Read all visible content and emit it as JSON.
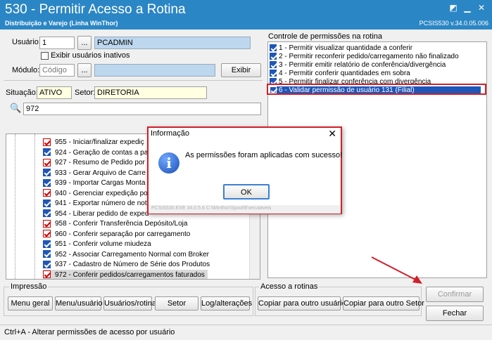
{
  "window": {
    "title": "530 - Permitir Acesso a Rotina",
    "subtitle": "Distribuição e Varejo (Linha WinThor)",
    "version": "PCSIS530  v.34.0.05.006"
  },
  "form": {
    "usuario_label": "Usuário:",
    "usuario_code": "1",
    "usuario_name": "PCADMIN",
    "ellipsis": "...",
    "inativos_label": "Exibir usuários inativos",
    "modulo_label": "Módulo:",
    "modulo_placeholder": "Código",
    "exibir_label": "Exibir",
    "situacao_label": "Situação:",
    "situacao_value": "ATIVO",
    "setor_label": "Setor:",
    "setor_value": "DIRETORIA",
    "search_value": "972"
  },
  "controle": {
    "title": "Controle de permissões na rotina",
    "items": [
      {
        "label": "1 - Permitir visualizar quantidade a conferir",
        "checked": true
      },
      {
        "label": "2 - Permitir reconferir pedido/carregamento não finalizado",
        "checked": true
      },
      {
        "label": "3 - Permitir emitir relatório de conferência/divergência",
        "checked": true
      },
      {
        "label": "4 - Permitir conferir quantidades em sobra",
        "checked": true
      },
      {
        "label": "5 - Permitir finalizar conferência com divergência",
        "checked": true
      },
      {
        "label": "6 - Validar permissão de usuário 131 (Filial)",
        "checked": true
      }
    ]
  },
  "rotinas": [
    {
      "label": "955 - Iniciar/finalizar expediç",
      "mark": "red"
    },
    {
      "label": "924 - Geração de contas a pa",
      "mark": "on"
    },
    {
      "label": "927 - Resumo de Pedido por F",
      "mark": "red"
    },
    {
      "label": "933 - Gerar Arquivo de Carre",
      "mark": "on"
    },
    {
      "label": "939 - Importar Cargas Monta",
      "mark": "on"
    },
    {
      "label": "940 - Gerenciar expedição po",
      "mark": "red"
    },
    {
      "label": "941 - Exportar número de not",
      "mark": "on"
    },
    {
      "label": "954 - Liberar pedido de exped",
      "mark": "on"
    },
    {
      "label": "958 - Conferir Transferência Depósito/Loja",
      "mark": "red"
    },
    {
      "label": "960 - Conferir separação por carregamento",
      "mark": "red"
    },
    {
      "label": "951 - Conferir volume miudeza",
      "mark": "on"
    },
    {
      "label": "952 - Associar Carregamento Normal com Broker",
      "mark": "on"
    },
    {
      "label": "937 - Cadastro de Número de Série dos Produtos",
      "mark": "on"
    },
    {
      "label": "972 - Conferir pedidos/carregamentos faturados",
      "mark": "red"
    }
  ],
  "impressao": {
    "title": "Impressão",
    "buttons": [
      "Menu geral",
      "Menu/usuário",
      "Usuários/rotina",
      "Setor",
      "Log/alterações"
    ]
  },
  "acesso": {
    "title": "Acesso a rotinas",
    "buttons": [
      "Copiar para outro usuário",
      "Copiar para outro Setor"
    ]
  },
  "actions": {
    "confirmar": "Confirmar",
    "fechar": "Fechar"
  },
  "status": "Ctrl+A - Alterar permissões de acesso por usuário",
  "dialog": {
    "title": "Informação",
    "message": "As permissões foram aplicadas com sucesso!",
    "ok": "OK",
    "footer": "PCSIS530.EXE 34.0.5.6 C:\\Winthor\\Spool\\Executaveis"
  },
  "colors": {
    "accent": "#2b86c5",
    "highlight": "#1f56b8",
    "annotation": "#d0202a"
  }
}
